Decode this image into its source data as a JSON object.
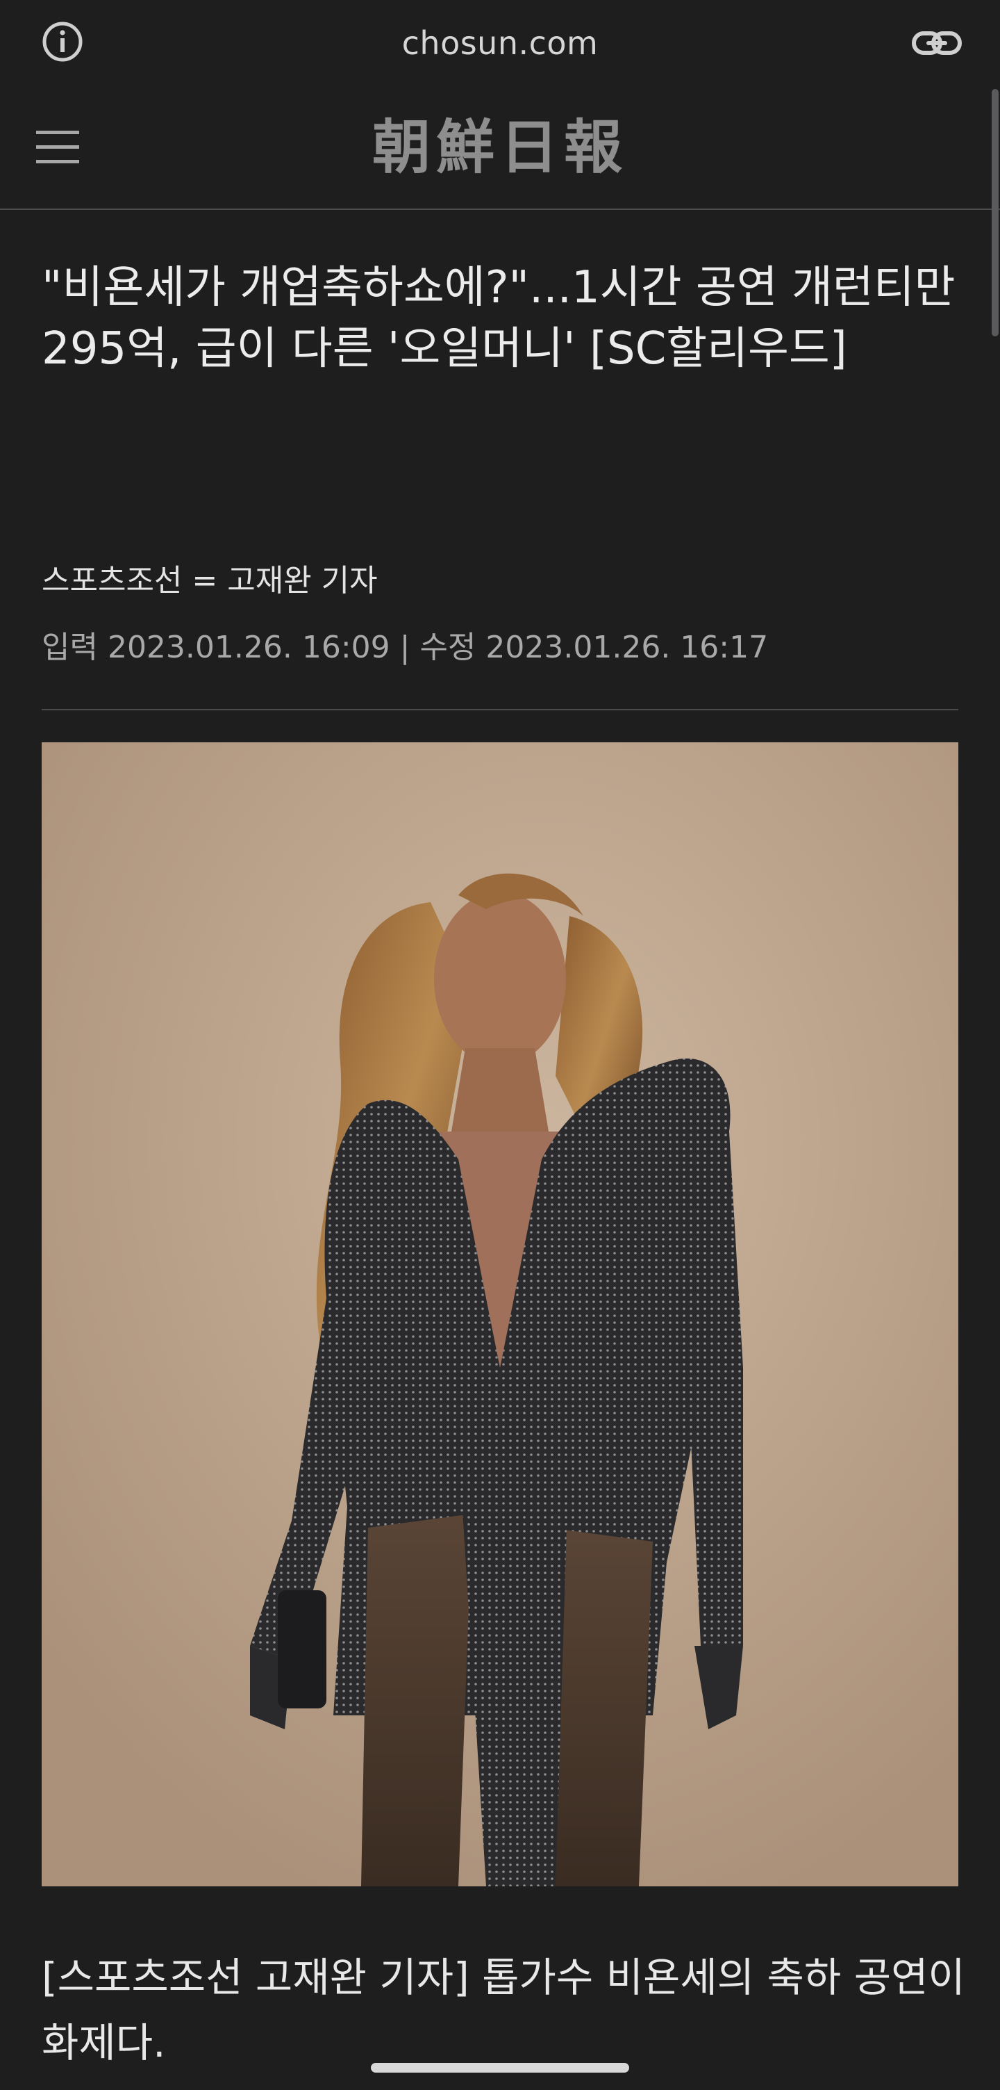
{
  "browser": {
    "url": "chosun.com",
    "info_icon": "info-icon",
    "link_icon": "link-icon"
  },
  "header": {
    "menu_icon": "hamburger-menu-icon",
    "logo_text": "朝鮮日報"
  },
  "article": {
    "headline": "\"비욘세가 개업축하쇼에?\"...1시간 공연 개런티만 295억, 급이 다른 '오일머니' [SC할리우드]",
    "byline": "스포츠조선 = 고재완 기자",
    "dates": "입력 2023.01.26. 16:09 | 수정 2023.01.26. 16:17",
    "photo_subject": "performer-photo",
    "body_text": "[스포츠조선 고재완 기자] 톱가수 비욘세의 축하 공연이 화제다."
  },
  "colors": {
    "background": "#1e1e1f",
    "text": "#ececec",
    "muted": "#a9a9a9",
    "divider": "#4c4c4e",
    "photo_background": "#c2aa92"
  }
}
